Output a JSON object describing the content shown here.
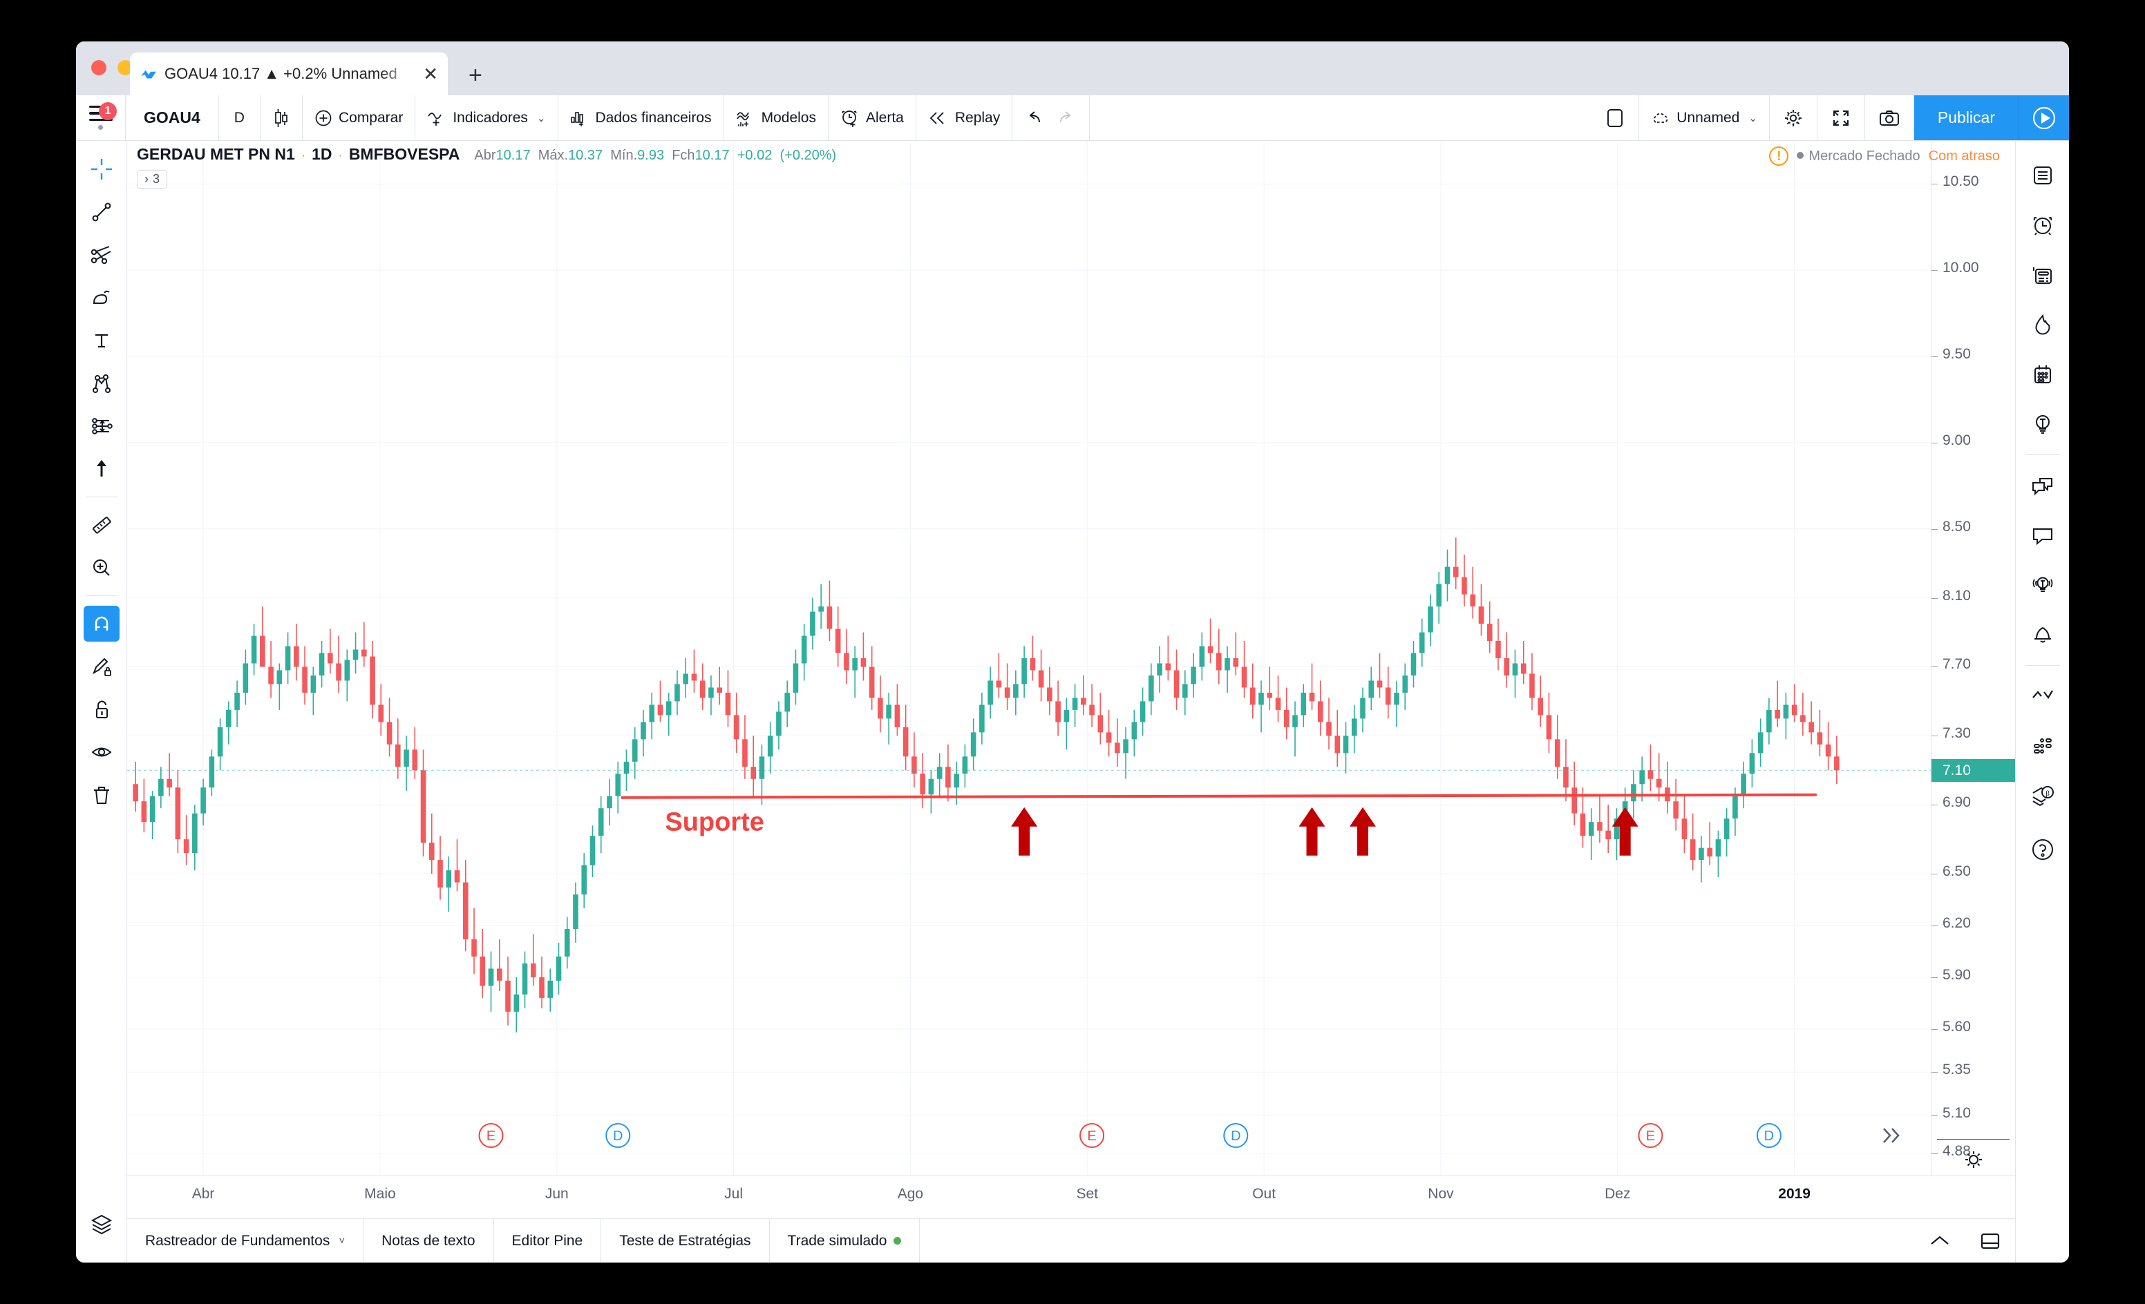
{
  "browser": {
    "tab_title": "GOAU4 10.17 ▲ +0.2% Unnamed",
    "close_label": "✕",
    "new_tab_label": "+"
  },
  "toolbar": {
    "menu_badge": "1",
    "symbol": "GOAU4",
    "interval": "D",
    "chart_style_icon": "candlestick-icon",
    "compare": "Comparar",
    "indicators": "Indicadores",
    "financials": "Dados financeiros",
    "templates": "Modelos",
    "alert": "Alerta",
    "replay": "Replay",
    "layout_name": "Unnamed",
    "publish": "Publicar",
    "accent_color": "#2196f3"
  },
  "legend": {
    "name": "GERDAU MET PN N1",
    "interval": "1D",
    "exchange": "BMFBOVESPA",
    "ohlc": [
      {
        "label": "Abr",
        "value": "10.17"
      },
      {
        "label": "Máx.",
        "value": "10.37"
      },
      {
        "label": "Mín.",
        "value": "9.93"
      },
      {
        "label": "Fch",
        "value": "10.17"
      }
    ],
    "change": "+0.02",
    "change_pct": "(+0.20%)",
    "up_color": "#2fae9b",
    "studies_chip": "3"
  },
  "status": {
    "warning_icon": "!",
    "market": "Mercado Fechado",
    "delay": "Com atraso",
    "delay_color": "#ff8a3c"
  },
  "price_axis": {
    "ticks": [
      "10.50",
      "10.00",
      "9.50",
      "9.00",
      "8.50",
      "8.10",
      "7.70",
      "7.30",
      "6.90",
      "6.50",
      "6.20",
      "5.90",
      "5.60",
      "5.35",
      "5.10",
      "4.88"
    ],
    "last_price": "7.10",
    "last_bg": "#2fae9b"
  },
  "time_axis": {
    "ticks": [
      "Abr",
      "Maio",
      "Jun",
      "Jul",
      "Ago",
      "Set",
      "Out",
      "Nov",
      "Dez",
      "2019"
    ],
    "bold_tick": "2019"
  },
  "chart_events": [
    {
      "label": "E",
      "color": "#f4433f",
      "month": "Maio"
    },
    {
      "label": "D",
      "color": "#2196f3",
      "month": "Maio"
    },
    {
      "label": "E",
      "color": "#f4433f",
      "month": "Ago"
    },
    {
      "label": "D",
      "color": "#2196f3",
      "month": "Set"
    },
    {
      "label": "E",
      "color": "#f4433f",
      "month": "Nov"
    },
    {
      "label": "D",
      "color": "#2196f3",
      "month": "Nov"
    }
  ],
  "annotations": {
    "support_label": "Suporte",
    "support_color": "#f4433f",
    "support_price": "6.95",
    "arrow_color": "#c00000",
    "arrow_count": 4
  },
  "bottom_tabs": [
    {
      "label": "Rastreador de Fundamentos",
      "chevron": "˅",
      "dot": false
    },
    {
      "label": "Notas de texto",
      "chevron": "",
      "dot": false
    },
    {
      "label": "Editor Pine",
      "chevron": "",
      "dot": false
    },
    {
      "label": "Teste de Estratégias",
      "chevron": "",
      "dot": false
    },
    {
      "label": "Trade simulado",
      "chevron": "",
      "dot": true
    }
  ],
  "left_tools": [
    "crosshair-icon",
    "trend-line-icon",
    "fib-fork-icon",
    "brush-icon",
    "text-icon",
    "pattern-icon",
    "forecast-icon",
    "arrow-up-icon",
    "ruler-icon",
    "zoom-in-icon",
    "magnet-icon",
    "draw-lock-icon",
    "lock-icon",
    "eye-icon",
    "trash-icon",
    "layers-icon"
  ],
  "right_tools": [
    "watchlist-icon",
    "alarm-clock-icon",
    "news-icon",
    "hotlist-icon",
    "calendar-icon",
    "ideas-icon",
    "chat-group-icon",
    "chat-icon",
    "broadcast-icon",
    "bell-icon",
    "stock-screener-icon",
    "dom-icon",
    "beta-layers-icon",
    "help-icon"
  ],
  "chart_data": {
    "type": "candlestick",
    "title": "GERDAU MET PN N1 · 1D · BMFBOVESPA",
    "ylabel": "",
    "xlabel": "",
    "ylim": [
      4.75,
      10.75
    ],
    "up_color": "#2fae9b",
    "down_color": "#f4595c",
    "support_level": 6.95,
    "candles": [
      [
        7.02,
        7.15,
        6.86,
        6.92
      ],
      [
        6.92,
        7.05,
        6.74,
        6.8
      ],
      [
        6.8,
        6.98,
        6.7,
        6.95
      ],
      [
        6.95,
        7.12,
        6.88,
        7.05
      ],
      [
        7.05,
        7.2,
        6.95,
        7.0
      ],
      [
        7.0,
        7.1,
        6.62,
        6.7
      ],
      [
        6.7,
        6.84,
        6.55,
        6.62
      ],
      [
        6.62,
        6.9,
        6.52,
        6.85
      ],
      [
        6.85,
        7.05,
        6.78,
        7.0
      ],
      [
        7.0,
        7.22,
        6.95,
        7.18
      ],
      [
        7.18,
        7.4,
        7.1,
        7.35
      ],
      [
        7.35,
        7.5,
        7.25,
        7.45
      ],
      [
        7.45,
        7.62,
        7.35,
        7.55
      ],
      [
        7.55,
        7.8,
        7.48,
        7.72
      ],
      [
        7.72,
        7.95,
        7.65,
        7.88
      ],
      [
        7.88,
        8.05,
        7.78,
        7.7
      ],
      [
        7.7,
        7.85,
        7.52,
        7.6
      ],
      [
        7.6,
        7.72,
        7.45,
        7.68
      ],
      [
        7.68,
        7.9,
        7.6,
        7.82
      ],
      [
        7.82,
        7.95,
        7.62,
        7.7
      ],
      [
        7.7,
        7.82,
        7.48,
        7.55
      ],
      [
        7.55,
        7.7,
        7.42,
        7.65
      ],
      [
        7.65,
        7.85,
        7.58,
        7.78
      ],
      [
        7.78,
        7.92,
        7.66,
        7.72
      ],
      [
        7.72,
        7.88,
        7.55,
        7.62
      ],
      [
        7.62,
        7.8,
        7.5,
        7.74
      ],
      [
        7.74,
        7.9,
        7.66,
        7.8
      ],
      [
        7.8,
        7.96,
        7.7,
        7.76
      ],
      [
        7.76,
        7.85,
        7.4,
        7.48
      ],
      [
        7.48,
        7.6,
        7.3,
        7.38
      ],
      [
        7.38,
        7.52,
        7.18,
        7.25
      ],
      [
        7.25,
        7.4,
        7.05,
        7.12
      ],
      [
        7.12,
        7.3,
        6.98,
        7.22
      ],
      [
        7.22,
        7.35,
        7.05,
        7.1
      ],
      [
        7.1,
        7.22,
        6.6,
        6.68
      ],
      [
        6.68,
        6.85,
        6.5,
        6.58
      ],
      [
        6.58,
        6.72,
        6.35,
        6.42
      ],
      [
        6.42,
        6.6,
        6.28,
        6.52
      ],
      [
        6.52,
        6.7,
        6.4,
        6.45
      ],
      [
        6.45,
        6.58,
        6.05,
        6.12
      ],
      [
        6.12,
        6.3,
        5.92,
        6.02
      ],
      [
        6.02,
        6.18,
        5.78,
        5.85
      ],
      [
        5.85,
        6.05,
        5.7,
        5.95
      ],
      [
        5.95,
        6.12,
        5.82,
        5.88
      ],
      [
        5.88,
        6.02,
        5.62,
        5.7
      ],
      [
        5.7,
        5.9,
        5.58,
        5.8
      ],
      [
        5.8,
        6.05,
        5.72,
        5.98
      ],
      [
        5.98,
        6.15,
        5.85,
        5.9
      ],
      [
        5.9,
        6.02,
        5.72,
        5.78
      ],
      [
        5.78,
        5.95,
        5.7,
        5.88
      ],
      [
        5.88,
        6.1,
        5.8,
        6.02
      ],
      [
        6.02,
        6.25,
        5.95,
        6.18
      ],
      [
        6.18,
        6.45,
        6.1,
        6.38
      ],
      [
        6.38,
        6.62,
        6.3,
        6.55
      ],
      [
        6.55,
        6.78,
        6.48,
        6.72
      ],
      [
        6.72,
        6.95,
        6.62,
        6.88
      ],
      [
        6.88,
        7.05,
        6.78,
        6.95
      ],
      [
        6.95,
        7.15,
        6.85,
        7.08
      ],
      [
        7.08,
        7.22,
        6.98,
        7.15
      ],
      [
        7.15,
        7.35,
        7.05,
        7.28
      ],
      [
        7.28,
        7.45,
        7.18,
        7.38
      ],
      [
        7.38,
        7.55,
        7.28,
        7.48
      ],
      [
        7.48,
        7.62,
        7.38,
        7.42
      ],
      [
        7.42,
        7.55,
        7.3,
        7.5
      ],
      [
        7.5,
        7.68,
        7.42,
        7.6
      ],
      [
        7.6,
        7.75,
        7.52,
        7.66
      ],
      [
        7.66,
        7.8,
        7.55,
        7.62
      ],
      [
        7.62,
        7.72,
        7.45,
        7.52
      ],
      [
        7.52,
        7.65,
        7.42,
        7.58
      ],
      [
        7.58,
        7.7,
        7.48,
        7.55
      ],
      [
        7.55,
        7.68,
        7.35,
        7.42
      ],
      [
        7.42,
        7.55,
        7.2,
        7.28
      ],
      [
        7.28,
        7.42,
        7.05,
        7.12
      ],
      [
        7.12,
        7.3,
        6.95,
        7.05
      ],
      [
        7.05,
        7.25,
        6.9,
        7.18
      ],
      [
        7.18,
        7.38,
        7.08,
        7.3
      ],
      [
        7.3,
        7.5,
        7.22,
        7.44
      ],
      [
        7.44,
        7.62,
        7.35,
        7.55
      ],
      [
        7.55,
        7.8,
        7.48,
        7.72
      ],
      [
        7.72,
        7.95,
        7.62,
        7.88
      ],
      [
        7.88,
        8.1,
        7.8,
        8.02
      ],
      [
        8.02,
        8.18,
        7.92,
        8.05
      ],
      [
        8.05,
        8.2,
        7.85,
        7.92
      ],
      [
        7.92,
        8.05,
        7.7,
        7.78
      ],
      [
        7.78,
        7.92,
        7.6,
        7.68
      ],
      [
        7.68,
        7.82,
        7.52,
        7.75
      ],
      [
        7.75,
        7.9,
        7.62,
        7.7
      ],
      [
        7.7,
        7.82,
        7.45,
        7.52
      ],
      [
        7.52,
        7.65,
        7.32,
        7.4
      ],
      [
        7.4,
        7.55,
        7.25,
        7.48
      ],
      [
        7.48,
        7.6,
        7.3,
        7.35
      ],
      [
        7.35,
        7.48,
        7.1,
        7.18
      ],
      [
        7.18,
        7.32,
        7.0,
        7.08
      ],
      [
        7.08,
        7.2,
        6.88,
        6.96
      ],
      [
        6.96,
        7.1,
        6.85,
        7.05
      ],
      [
        7.05,
        7.2,
        6.95,
        7.12
      ],
      [
        7.12,
        7.25,
        6.92,
        7.0
      ],
      [
        7.0,
        7.15,
        6.9,
        7.08
      ],
      [
        7.08,
        7.25,
        7.0,
        7.18
      ],
      [
        7.18,
        7.4,
        7.1,
        7.32
      ],
      [
        7.32,
        7.55,
        7.25,
        7.48
      ],
      [
        7.48,
        7.7,
        7.4,
        7.62
      ],
      [
        7.62,
        7.78,
        7.52,
        7.58
      ],
      [
        7.58,
        7.72,
        7.45,
        7.52
      ],
      [
        7.52,
        7.68,
        7.42,
        7.6
      ],
      [
        7.6,
        7.82,
        7.52,
        7.75
      ],
      [
        7.75,
        7.88,
        7.62,
        7.68
      ],
      [
        7.68,
        7.8,
        7.5,
        7.58
      ],
      [
        7.58,
        7.7,
        7.42,
        7.5
      ],
      [
        7.5,
        7.62,
        7.3,
        7.38
      ],
      [
        7.38,
        7.52,
        7.22,
        7.45
      ],
      [
        7.45,
        7.6,
        7.35,
        7.52
      ],
      [
        7.52,
        7.65,
        7.42,
        7.48
      ],
      [
        7.48,
        7.6,
        7.35,
        7.42
      ],
      [
        7.42,
        7.55,
        7.25,
        7.32
      ],
      [
        7.32,
        7.45,
        7.18,
        7.26
      ],
      [
        7.26,
        7.4,
        7.12,
        7.2
      ],
      [
        7.2,
        7.35,
        7.05,
        7.28
      ],
      [
        7.28,
        7.45,
        7.18,
        7.38
      ],
      [
        7.38,
        7.58,
        7.3,
        7.5
      ],
      [
        7.5,
        7.72,
        7.42,
        7.65
      ],
      [
        7.65,
        7.82,
        7.55,
        7.72
      ],
      [
        7.72,
        7.88,
        7.62,
        7.68
      ],
      [
        7.68,
        7.8,
        7.45,
        7.52
      ],
      [
        7.52,
        7.68,
        7.42,
        7.6
      ],
      [
        7.6,
        7.78,
        7.52,
        7.7
      ],
      [
        7.7,
        7.9,
        7.62,
        7.82
      ],
      [
        7.82,
        7.98,
        7.72,
        7.78
      ],
      [
        7.78,
        7.92,
        7.6,
        7.68
      ],
      [
        7.68,
        7.82,
        7.55,
        7.75
      ],
      [
        7.75,
        7.9,
        7.65,
        7.7
      ],
      [
        7.7,
        7.85,
        7.52,
        7.58
      ],
      [
        7.58,
        7.72,
        7.4,
        7.48
      ],
      [
        7.48,
        7.62,
        7.32,
        7.55
      ],
      [
        7.55,
        7.7,
        7.45,
        7.52
      ],
      [
        7.52,
        7.65,
        7.38,
        7.45
      ],
      [
        7.45,
        7.58,
        7.28,
        7.35
      ],
      [
        7.35,
        7.5,
        7.18,
        7.42
      ],
      [
        7.42,
        7.6,
        7.35,
        7.55
      ],
      [
        7.55,
        7.72,
        7.45,
        7.5
      ],
      [
        7.5,
        7.62,
        7.3,
        7.38
      ],
      [
        7.38,
        7.52,
        7.22,
        7.3
      ],
      [
        7.3,
        7.45,
        7.12,
        7.2
      ],
      [
        7.2,
        7.38,
        7.08,
        7.3
      ],
      [
        7.3,
        7.48,
        7.2,
        7.4
      ],
      [
        7.4,
        7.58,
        7.32,
        7.52
      ],
      [
        7.52,
        7.7,
        7.45,
        7.62
      ],
      [
        7.62,
        7.78,
        7.52,
        7.58
      ],
      [
        7.58,
        7.7,
        7.4,
        7.48
      ],
      [
        7.48,
        7.62,
        7.35,
        7.55
      ],
      [
        7.55,
        7.72,
        7.45,
        7.65
      ],
      [
        7.65,
        7.85,
        7.58,
        7.78
      ],
      [
        7.78,
        7.98,
        7.7,
        7.9
      ],
      [
        7.9,
        8.12,
        7.82,
        8.05
      ],
      [
        8.05,
        8.25,
        7.95,
        8.18
      ],
      [
        8.18,
        8.38,
        8.08,
        8.28
      ],
      [
        8.28,
        8.45,
        8.15,
        8.22
      ],
      [
        8.22,
        8.35,
        8.05,
        8.12
      ],
      [
        8.12,
        8.28,
        7.98,
        8.05
      ],
      [
        8.05,
        8.18,
        7.88,
        7.95
      ],
      [
        7.95,
        8.08,
        7.78,
        7.85
      ],
      [
        7.85,
        7.98,
        7.68,
        7.75
      ],
      [
        7.75,
        7.9,
        7.58,
        7.65
      ],
      [
        7.65,
        7.8,
        7.52,
        7.72
      ],
      [
        7.72,
        7.85,
        7.6,
        7.66
      ],
      [
        7.66,
        7.78,
        7.45,
        7.52
      ],
      [
        7.52,
        7.65,
        7.35,
        7.42
      ],
      [
        7.42,
        7.55,
        7.2,
        7.28
      ],
      [
        7.28,
        7.42,
        7.05,
        7.12
      ],
      [
        7.12,
        7.28,
        6.92,
        7.0
      ],
      [
        7.0,
        7.15,
        6.78,
        6.85
      ],
      [
        6.85,
        7.0,
        6.65,
        6.72
      ],
      [
        6.72,
        6.88,
        6.58,
        6.8
      ],
      [
        6.8,
        6.95,
        6.68,
        6.75
      ],
      [
        6.75,
        6.9,
        6.62,
        6.7
      ],
      [
        6.7,
        6.88,
        6.58,
        6.82
      ],
      [
        6.82,
        7.0,
        6.72,
        6.92
      ],
      [
        6.92,
        7.1,
        6.82,
        7.02
      ],
      [
        7.02,
        7.18,
        6.92,
        7.1
      ],
      [
        7.1,
        7.25,
        6.98,
        7.05
      ],
      [
        7.05,
        7.2,
        6.92,
        7.0
      ],
      [
        7.0,
        7.15,
        6.85,
        6.92
      ],
      [
        6.92,
        7.05,
        6.75,
        6.82
      ],
      [
        6.82,
        6.95,
        6.62,
        6.7
      ],
      [
        6.7,
        6.85,
        6.52,
        6.58
      ],
      [
        6.58,
        6.72,
        6.45,
        6.65
      ],
      [
        6.65,
        6.8,
        6.55,
        6.6
      ],
      [
        6.6,
        6.75,
        6.48,
        6.7
      ],
      [
        6.7,
        6.88,
        6.6,
        6.82
      ],
      [
        6.82,
        7.0,
        6.72,
        6.95
      ],
      [
        6.95,
        7.15,
        6.88,
        7.08
      ],
      [
        7.08,
        7.28,
        7.0,
        7.2
      ],
      [
        7.2,
        7.4,
        7.12,
        7.32
      ],
      [
        7.32,
        7.52,
        7.25,
        7.45
      ],
      [
        7.45,
        7.62,
        7.35,
        7.4
      ],
      [
        7.4,
        7.55,
        7.28,
        7.48
      ],
      [
        7.48,
        7.6,
        7.38,
        7.42
      ],
      [
        7.42,
        7.55,
        7.3,
        7.38
      ],
      [
        7.38,
        7.5,
        7.25,
        7.32
      ],
      [
        7.32,
        7.45,
        7.18,
        7.25
      ],
      [
        7.25,
        7.38,
        7.1,
        7.18
      ],
      [
        7.18,
        7.3,
        7.02,
        7.1
      ]
    ]
  }
}
